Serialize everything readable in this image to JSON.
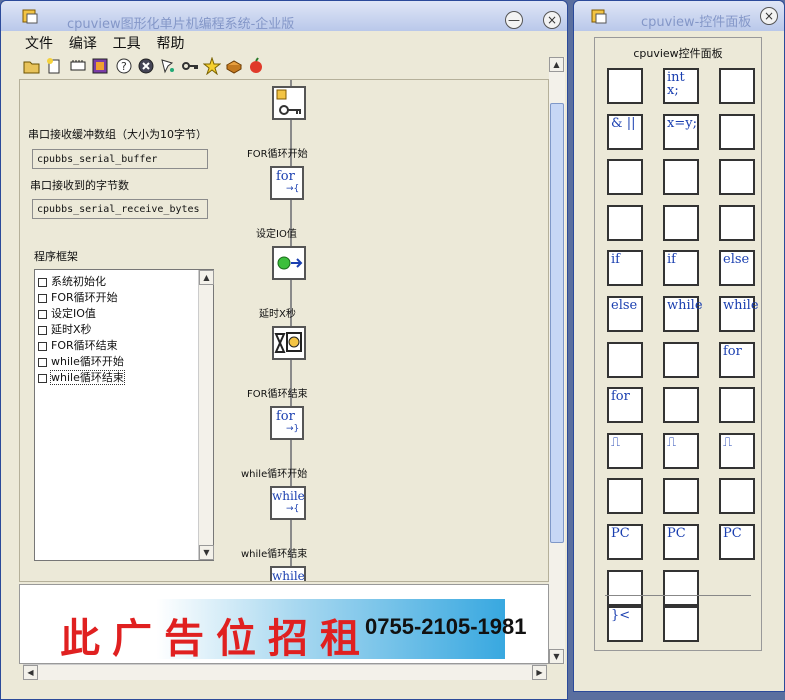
{
  "main_window": {
    "title": "cpuview图形化单片机编程系统-企业版",
    "min_glyph": "—",
    "close_glyph": "×"
  },
  "menu": [
    "文件",
    "编译",
    "工具",
    "帮助"
  ],
  "toolbar_icons": [
    "open-folder-icon",
    "new-file-icon",
    "memory-icon",
    "chip-icon",
    "help-icon",
    "stop-icon",
    "probe-icon",
    "key-icon",
    "star-icon",
    "package-icon",
    "apple-icon"
  ],
  "fields": {
    "buffer_label": "串口接收缓冲数组（大小为10字节）",
    "buffer_value": "cpubbs_serial_buffer",
    "count_label": "串口接收到的字节数",
    "count_value": "cpubbs_serial_receive_bytes"
  },
  "tree": {
    "label": "程序框架",
    "items": [
      "系统初始化",
      "FOR循环开始",
      "设定IO值",
      "延时X秒",
      "FOR循环结束",
      "while循环开始",
      "while循环结束"
    ],
    "selected_index": 6
  },
  "flow": {
    "nodes": [
      {
        "label": "",
        "glyph": ""
      },
      {
        "label": "FOR循环开始",
        "glyph": "for"
      },
      {
        "label": "设定IO值",
        "glyph": ""
      },
      {
        "label": "延时X秒",
        "glyph": ""
      },
      {
        "label": "FOR循环结束",
        "glyph": "for"
      },
      {
        "label": "while循环开始",
        "glyph": "while"
      },
      {
        "label": "while循环结束",
        "glyph": "while"
      }
    ]
  },
  "ad": {
    "text": "此广告位招租",
    "phone": "0755-2105-1981"
  },
  "panel_window": {
    "title": "cpuview-控件面板",
    "close_glyph": "×",
    "frame_title": "cpuview控件面板",
    "buttons": [
      {
        "icon": "init-key-icon",
        "glyph": ""
      },
      {
        "icon": "int-declare-icon",
        "glyph": "int x;"
      },
      {
        "icon": "funnel-key-icon",
        "glyph": ""
      },
      {
        "icon": "logic-ops-icon",
        "glyph": "& ||"
      },
      {
        "icon": "assign-icon",
        "glyph": "x=y;"
      },
      {
        "icon": "doc-search-icon",
        "glyph": ""
      },
      {
        "icon": "doc-search2-icon",
        "glyph": ""
      },
      {
        "icon": "signal-key-icon",
        "glyph": ""
      },
      {
        "icon": "io-in-icon",
        "glyph": ""
      },
      {
        "icon": "io-read-icon",
        "glyph": ""
      },
      {
        "icon": "green-out-icon",
        "glyph": ""
      },
      {
        "icon": "green-in-icon",
        "glyph": ""
      },
      {
        "icon": "if-icon",
        "glyph": "if"
      },
      {
        "icon": "if-end-icon",
        "glyph": "if"
      },
      {
        "icon": "else-icon",
        "glyph": "else"
      },
      {
        "icon": "else-end-icon",
        "glyph": "else"
      },
      {
        "icon": "while-icon",
        "glyph": "while"
      },
      {
        "icon": "while-end-icon",
        "glyph": "while"
      },
      {
        "icon": "funnel-arrow-icon",
        "glyph": ""
      },
      {
        "icon": "funnel-cnt-icon",
        "glyph": ""
      },
      {
        "icon": "for-icon",
        "glyph": "for"
      },
      {
        "icon": "for-end-icon",
        "glyph": "for"
      },
      {
        "icon": "delay-icon",
        "glyph": ""
      },
      {
        "icon": "edit-icon",
        "glyph": ""
      },
      {
        "icon": "pulse-key-icon",
        "glyph": "⎍"
      },
      {
        "icon": "pulse-in-icon",
        "glyph": "⎍"
      },
      {
        "icon": "pulse-out-icon",
        "glyph": "⎍"
      },
      {
        "icon": "timer-icon",
        "glyph": ""
      },
      {
        "icon": "timer-end-icon",
        "glyph": ""
      },
      {
        "icon": "go-stop-icon",
        "glyph": ""
      },
      {
        "icon": "pc-key-icon",
        "glyph": "PC"
      },
      {
        "icon": "pc-send-icon",
        "glyph": "PC"
      },
      {
        "icon": "pc-receive-icon",
        "glyph": "PC"
      },
      {
        "icon": "new-doc-icon",
        "glyph": ""
      },
      {
        "icon": "users-icon",
        "glyph": ""
      }
    ],
    "bottom_buttons": [
      {
        "icon": "call-icon",
        "glyph": "}<"
      },
      {
        "icon": "cancel-icon",
        "glyph": ""
      }
    ]
  }
}
